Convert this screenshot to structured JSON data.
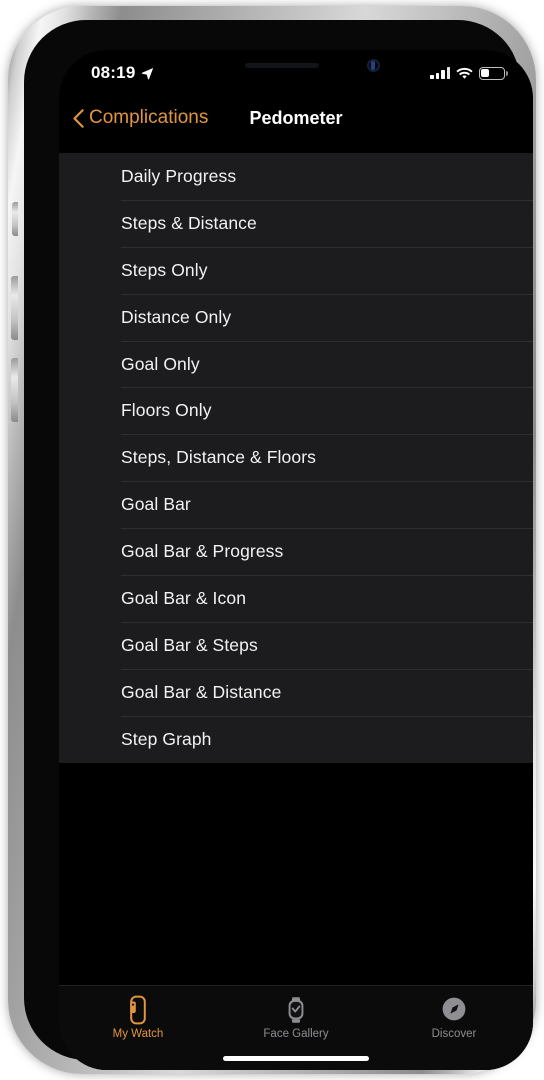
{
  "status_bar": {
    "time": "08:19",
    "location_icon": "location-arrow-icon",
    "signal_icon": "cellular-signal-icon",
    "signal_bars": 4,
    "wifi_icon": "wifi-icon",
    "battery_icon": "battery-icon",
    "battery_level_pct": 30
  },
  "nav_bar": {
    "back_icon": "chevron-left-icon",
    "back_label": "Complications",
    "title": "Pedometer",
    "accent_color": "#e09540"
  },
  "list": {
    "items": [
      {
        "label": "Daily Progress"
      },
      {
        "label": "Steps & Distance"
      },
      {
        "label": "Steps Only"
      },
      {
        "label": "Distance Only"
      },
      {
        "label": "Goal Only"
      },
      {
        "label": "Floors Only"
      },
      {
        "label": "Steps, Distance & Floors"
      },
      {
        "label": "Goal Bar"
      },
      {
        "label": "Goal Bar & Progress"
      },
      {
        "label": "Goal Bar & Icon"
      },
      {
        "label": "Goal Bar & Steps"
      },
      {
        "label": "Goal Bar & Distance"
      },
      {
        "label": "Step Graph"
      }
    ]
  },
  "tab_bar": {
    "tabs": [
      {
        "label": "My Watch",
        "icon": "apple-watch-icon",
        "active": true
      },
      {
        "label": "Face Gallery",
        "icon": "watch-face-icon",
        "active": false
      },
      {
        "label": "Discover",
        "icon": "compass-icon",
        "active": false
      }
    ],
    "active_color": "#e09540",
    "inactive_color": "#8e8e93"
  }
}
